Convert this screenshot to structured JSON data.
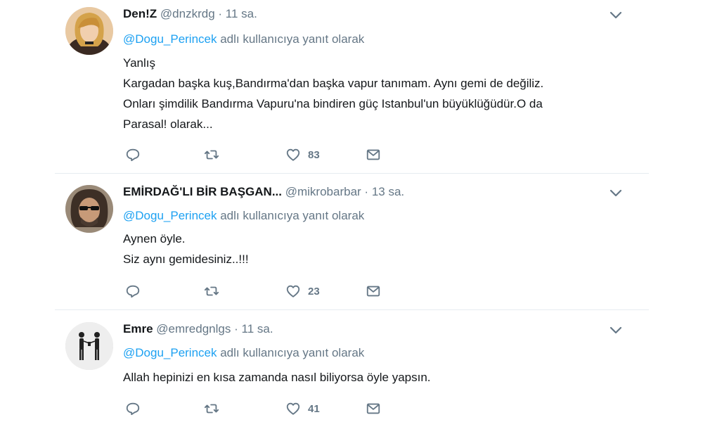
{
  "tweets": [
    {
      "name": "Den!Z",
      "handle": "@dnzkrdg",
      "dot": "·",
      "time": "11 sa.",
      "reply_mention": "@Dogu_Perincek",
      "reply_suffix": " adlı kullanıcıya yanıt olarak",
      "lines": [
        "Yanlış",
        "Kargadan başka kuş,Bandırma'dan başka vapur tanımam. Aynı gemi de  değiliz.",
        "Onları şimdilik Bandırma Vapuru'na bindiren güç Istanbul'un büyüklüğüdür.O da",
        "Parasal! olarak..."
      ],
      "likes": "83"
    },
    {
      "name": "EMİRDAĞ'LI BİR BAŞGAN...",
      "handle": "@mikrobarbar",
      "dot": "·",
      "time": "13 sa.",
      "reply_mention": "@Dogu_Perincek",
      "reply_suffix": " adlı kullanıcıya yanıt olarak",
      "lines": [
        "Aynen öyle.",
        "Siz aynı gemidesiniz..!!!"
      ],
      "likes": "23"
    },
    {
      "name": "Emre",
      "handle": "@emredgnlgs",
      "dot": "·",
      "time": "11 sa.",
      "reply_mention": "@Dogu_Perincek",
      "reply_suffix": " adlı kullanıcıya yanıt olarak",
      "lines": [
        "Allah hepinizi en kısa zamanda nasıl biliyorsa öyle yapsın."
      ],
      "likes": "41"
    }
  ],
  "icons": {
    "reply": "reply-icon",
    "retweet": "retweet-icon",
    "like": "heart-icon",
    "message": "envelope-icon",
    "caret": "chevron-down-icon"
  },
  "colors": {
    "mention": "#1da1f2",
    "secondary": "#657786",
    "text": "#14171a",
    "divider": "#e6ecf0"
  }
}
